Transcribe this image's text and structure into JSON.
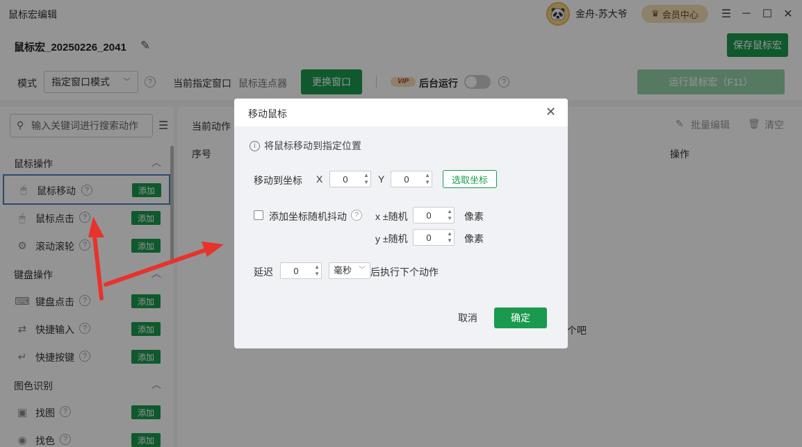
{
  "app": {
    "title": "鼠标宏编辑"
  },
  "user": {
    "name": "金舟-苏大爷",
    "vip_label": "会员中心"
  },
  "macro": {
    "name": "鼠标宏_20250226_2041",
    "save_label": "保存鼠标宏"
  },
  "toolbar": {
    "mode_label": "模式",
    "mode_value": "指定窗口模式",
    "current_window_label": "当前指定窗口",
    "current_window_value": "鼠标连点器",
    "change_window_label": "更换窗口",
    "vip_badge": "VIP",
    "background_run_label": "后台运行",
    "run_label": "运行鼠标宏（F11）"
  },
  "sidebar": {
    "search_placeholder": "输入关键词进行搜索动作",
    "add_label": "添加",
    "categories": [
      {
        "label": "鼠标操作",
        "items": [
          {
            "label": "鼠标移动",
            "icon": "mouse-icon"
          },
          {
            "label": "鼠标点击",
            "icon": "mouse-click-icon"
          },
          {
            "label": "滚动滚轮",
            "icon": "scroll-wheel-icon"
          }
        ]
      },
      {
        "label": "键盘操作",
        "items": [
          {
            "label": "键盘点击",
            "icon": "keyboard-icon"
          },
          {
            "label": "快捷输入",
            "icon": "quick-input-icon"
          },
          {
            "label": "快捷按键",
            "icon": "shortcut-key-icon"
          }
        ]
      },
      {
        "label": "图色识别",
        "items": [
          {
            "label": "找图",
            "icon": "image-icon"
          },
          {
            "label": "找色",
            "icon": "color-icon"
          }
        ]
      }
    ]
  },
  "main": {
    "current_actions_label": "当前动作",
    "batch_edit_label": "批量编辑",
    "clear_label": "清空",
    "col_index": "序号",
    "col_action": "操作",
    "empty_hint": "个吧"
  },
  "dialog": {
    "title": "移动鼠标",
    "info": "将鼠标移动到指定位置",
    "move_to_label": "移动到坐标",
    "x_label": "X",
    "y_label": "Y",
    "x_value": "0",
    "y_value": "0",
    "pick_label": "选取坐标",
    "jitter_label": "添加坐标随机抖动",
    "x_jitter_label": "x ±随机",
    "y_jitter_label": "y ±随机",
    "x_jitter_value": "0",
    "y_jitter_value": "0",
    "pixel_unit": "像素",
    "delay_label": "延迟",
    "delay_value": "0",
    "delay_unit": "毫秒",
    "after_label": "后执行下个动作",
    "cancel_label": "取消",
    "ok_label": "确定"
  },
  "colors": {
    "accent": "#1a9a4e",
    "annotation": "#e8322c",
    "highlight": "#4a7ec2"
  }
}
